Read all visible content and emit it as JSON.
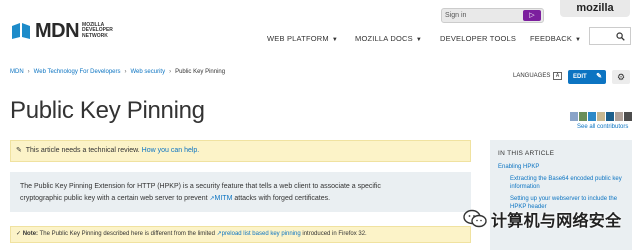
{
  "header": {
    "logo_text": "MDN",
    "logo_sub": "MOZILLA DEVELOPER NETWORK",
    "mozilla_tab": "mozilla",
    "signin_label": "Sign in",
    "nav": [
      {
        "label": "WEB PLATFORM",
        "caret": true
      },
      {
        "label": "MOZILLA DOCS",
        "caret": true
      },
      {
        "label": "DEVELOPER TOOLS",
        "caret": false
      },
      {
        "label": "FEEDBACK",
        "caret": true
      }
    ]
  },
  "breadcrumb": {
    "items": [
      "MDN",
      "Web Technology For Developers",
      "Web security"
    ],
    "current": "Public Key Pinning"
  },
  "toolbar": {
    "languages_label": "LANGUAGES",
    "edit_label": "EDIT"
  },
  "page": {
    "title": "Public Key Pinning",
    "see_all_contributors": "See all contributors",
    "review_banner_text": "This article needs a technical review.",
    "review_banner_link": "How you can help.",
    "intro_line1": "The Public Key Pinning Extension for HTTP (HPKP) is a security feature that tells a web client to associate a specific",
    "intro_line2_prefix": "cryptographic public key with a certain web server to prevent",
    "intro_link": "MITM",
    "intro_line2_suffix": "attacks with forged certificates.",
    "note_label": "Note:",
    "note_text": "The Public Key Pinning described here is different from the limited",
    "note_link": "preload list based key pinning",
    "note_suffix": "introduced in Firefox 32."
  },
  "toc": {
    "title": "IN THIS ARTICLE",
    "items": [
      {
        "label": "Enabling HPKP",
        "level": 1
      },
      {
        "label": "Extracting the Base64 encoded public key information",
        "level": 2
      },
      {
        "label": "Setting up your webserver to include the HPKP header",
        "level": 2
      }
    ]
  },
  "watermark": {
    "text": "计算机与网络安全"
  },
  "colors": {
    "link": "#0c74c2",
    "banner_bg": "#fcf3c8",
    "panel_bg": "#eaeff2",
    "signin_accent": "#7c1f9e"
  }
}
